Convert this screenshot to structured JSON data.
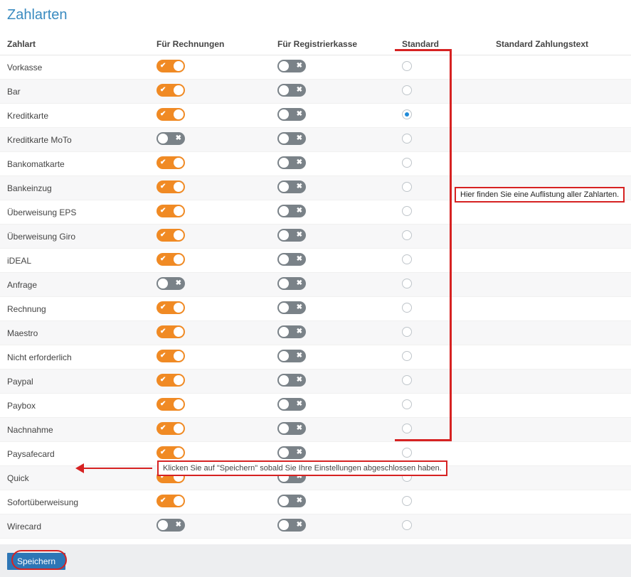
{
  "title": "Zahlarten",
  "columns": {
    "name": "Zahlart",
    "rech": "Für Rechnungen",
    "reg": "Für Registrierkasse",
    "std": "Standard",
    "text": "Standard Zahlungstext"
  },
  "rows": [
    {
      "name": "Vorkasse",
      "rech": true,
      "reg": false,
      "std": false
    },
    {
      "name": "Bar",
      "rech": true,
      "reg": false,
      "std": false
    },
    {
      "name": "Kreditkarte",
      "rech": true,
      "reg": false,
      "std": true
    },
    {
      "name": "Kreditkarte MoTo",
      "rech": false,
      "reg": false,
      "std": false
    },
    {
      "name": "Bankomatkarte",
      "rech": true,
      "reg": false,
      "std": false
    },
    {
      "name": "Bankeinzug",
      "rech": true,
      "reg": false,
      "std": false
    },
    {
      "name": "Überweisung EPS",
      "rech": true,
      "reg": false,
      "std": false
    },
    {
      "name": "Überweisung Giro",
      "rech": true,
      "reg": false,
      "std": false
    },
    {
      "name": "iDEAL",
      "rech": true,
      "reg": false,
      "std": false
    },
    {
      "name": "Anfrage",
      "rech": false,
      "reg": false,
      "std": false
    },
    {
      "name": "Rechnung",
      "rech": true,
      "reg": false,
      "std": false
    },
    {
      "name": "Maestro",
      "rech": true,
      "reg": false,
      "std": false
    },
    {
      "name": "Nicht erforderlich",
      "rech": true,
      "reg": false,
      "std": false
    },
    {
      "name": "Paypal",
      "rech": true,
      "reg": false,
      "std": false
    },
    {
      "name": "Paybox",
      "rech": true,
      "reg": false,
      "std": false
    },
    {
      "name": "Nachnahme",
      "rech": true,
      "reg": false,
      "std": false
    },
    {
      "name": "Paysafecard",
      "rech": true,
      "reg": false,
      "std": false
    },
    {
      "name": "Quick",
      "rech": true,
      "reg": false,
      "std": false
    },
    {
      "name": "Sofortüberweisung",
      "rech": true,
      "reg": false,
      "std": false
    },
    {
      "name": "Wirecard",
      "rech": false,
      "reg": false,
      "std": false
    }
  ],
  "save_label": "Speichern",
  "callout_list": "Hier finden Sie eine Auflistung aller Zahlarten.",
  "callout_save": "Klicken Sie auf \"Speichern\" sobald Sie Ihre Einstellungen abgeschlossen haben.",
  "glyphs": {
    "check": "✔",
    "cross": "✖"
  }
}
